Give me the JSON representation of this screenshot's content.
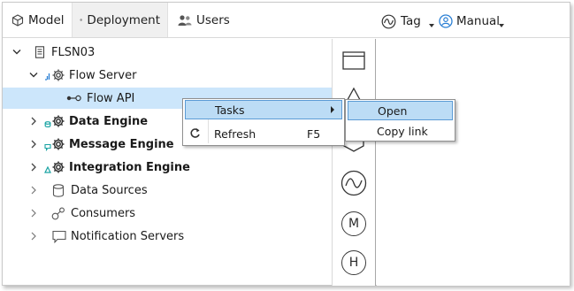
{
  "tabs": {
    "model": "Model",
    "deployment": "Deployment",
    "users": "Users"
  },
  "toolbar": {
    "tag_label": "Tag",
    "mode_label": "Manual"
  },
  "tree": {
    "root": "FLSN03",
    "flow_server": "Flow Server",
    "flow_api": "Flow API",
    "data_engine": "Data Engine",
    "message_engine": "Message Engine",
    "integration_engine": "Integration Engine",
    "data_sources": "Data Sources",
    "consumers": "Consumers",
    "notification_servers": "Notification Servers"
  },
  "vertical_toolbar": {
    "m_button": "M",
    "h_button": "H"
  },
  "context_menu": {
    "tasks": "Tasks",
    "refresh": "Refresh",
    "refresh_shortcut": "F5"
  },
  "submenu": {
    "open": "Open",
    "copy_link": "Copy link"
  },
  "colors": {
    "selection": "#cce6fb",
    "menu_highlight": "#bcdcf5",
    "menu_highlight_border": "#5b9bd5",
    "accent_blue": "#2a7fd4",
    "accent_teal": "#1aa3a3"
  }
}
